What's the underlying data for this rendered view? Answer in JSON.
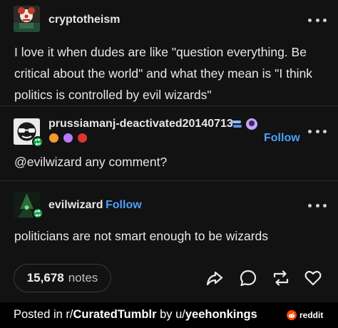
{
  "post1": {
    "username": "cryptotheism",
    "body": "I love it when dudes are like \"question everything. Be critical about the world\" and what they mean is \"I think politics is controlled by evil wizards\""
  },
  "post2": {
    "username": "prussiamanj-deactivated20140713",
    "follow_label": "Follow",
    "body": "@evilwizard any comment?"
  },
  "post3": {
    "username": "evilwizard",
    "follow_label": "Follow",
    "body": "politicians are not smart enough to be wizards"
  },
  "actions": {
    "notes_count": "15,678",
    "notes_label": "notes",
    "icons": [
      "share-icon",
      "reply-icon",
      "reblog-icon",
      "like-icon"
    ]
  },
  "footer": {
    "prefix": "Posted in r/",
    "subreddit": "CuratedTumblr",
    "by": " by u/",
    "user": "yeehonkings",
    "brand": "reddit"
  },
  "colors": {
    "background": "#121212",
    "follow": "#4ba0ff",
    "reblog_badge": "#11a54a",
    "reddit": "#ff4500"
  }
}
